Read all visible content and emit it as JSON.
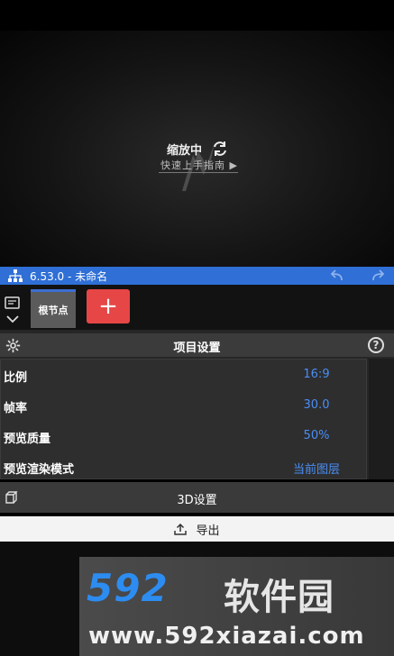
{
  "preview": {
    "status_text": "缩放中",
    "guide_link": "快速上手指南 ▶"
  },
  "titlebar": {
    "title": "6.53.0 - 未命名"
  },
  "tabs": {
    "root_tab": "根节点",
    "add_label": "+"
  },
  "project_settings": {
    "title": "项目设置",
    "help": "?",
    "rows": [
      {
        "label": "比例",
        "value": "16:9"
      },
      {
        "label": "帧率",
        "value": "30.0"
      },
      {
        "label": "预览质量",
        "value": "50%"
      },
      {
        "label": "预览渲染模式",
        "value": "当前图层"
      }
    ]
  },
  "section_3d": {
    "label": "3D设置"
  },
  "export": {
    "label": "导出"
  },
  "watermark": {
    "logo": "592",
    "brand": "软件园",
    "url": "www.592xiazai.com"
  },
  "colors": {
    "accent": "#2f6fd6",
    "value_blue": "#4a8ef5",
    "add_red": "#e64646"
  }
}
